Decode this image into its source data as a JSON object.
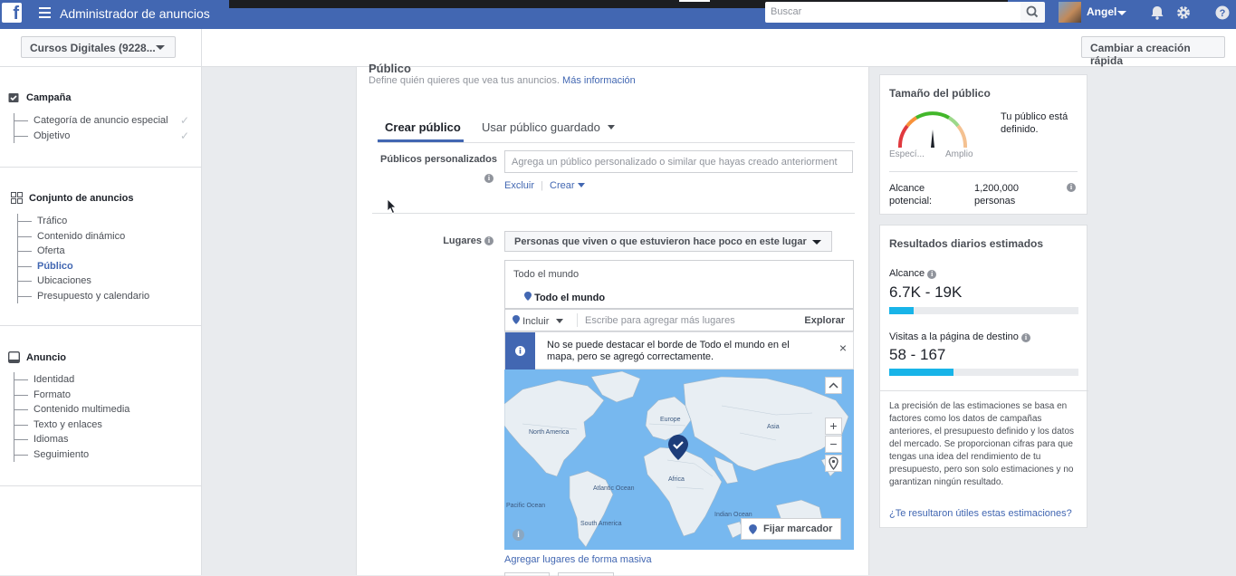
{
  "topbar": {
    "app_title": "Administrador de anuncios",
    "search_placeholder": "Buscar",
    "user_name": "Angel"
  },
  "subbar": {
    "account_label": "Cursos Digitales (9228...",
    "quick_create_label": "Cambiar a creación rápida"
  },
  "sidebar": {
    "campaign": {
      "title": "Campaña",
      "items": [
        "Categoría de anuncio especial",
        "Objetivo"
      ]
    },
    "adset": {
      "title": "Conjunto de anuncios",
      "items": [
        "Tráfico",
        "Contenido dinámico",
        "Oferta",
        "Público",
        "Ubicaciones",
        "Presupuesto y calendario"
      ],
      "active_index": 3
    },
    "ad": {
      "title": "Anuncio",
      "items": [
        "Identidad",
        "Formato",
        "Contenido multimedia",
        "Texto y enlaces",
        "Idiomas",
        "Seguimiento"
      ]
    }
  },
  "audience": {
    "title": "Público",
    "description": "Define quién quieres que vea tus anuncios.",
    "more_info_link": "Más información",
    "tabs": [
      "Crear público",
      "Usar público guardado"
    ],
    "custom_audiences_label": "Públicos personalizados",
    "custom_audiences_placeholder": "Agrega un público personalizado o similar que hayas creado anteriorment",
    "exclude_link": "Excluir",
    "create_link": "Crear",
    "places_label": "Lugares",
    "places_dropdown": "Personas que viven o que estuvieron hace poco en este lugar",
    "locations_header": "Todo el mundo",
    "selected_location": "Todo el mundo",
    "include_label": "Incluir",
    "add_places_placeholder": "Escribe para agregar más lugares",
    "explore_label": "Explorar",
    "notice_text": "No se puede destacar el borde de Todo el mundo en el mapa, pero se agregó correctamente.",
    "map_labels": [
      "North America",
      "Atlantic Ocean",
      "Pacific Ocean",
      "Indian Ocean",
      "South America",
      "Africa",
      "Asia",
      "Europe"
    ],
    "pin_marker_label": "Fijar marcador",
    "bulk_link": "Agregar lugares de forma masiva"
  },
  "audience_size": {
    "title": "Tamaño del público",
    "status": "Tu público está definido.",
    "gauge_left": "Especí...",
    "gauge_right": "Amplio",
    "reach_label": "Alcance potencial:",
    "reach_value": "1,200,000 personas"
  },
  "daily_results": {
    "title": "Resultados diarios estimados",
    "reach_label": "Alcance",
    "reach_value": "6.7K - 19K",
    "reach_fill": 0.13,
    "visits_label": "Visitas a la página de destino",
    "visits_value": "58 - 167",
    "visits_fill": 0.34,
    "disclaimer": "La precisión de las estimaciones se basa en factores como los datos de campañas anteriores, el presupuesto definido y los datos del mercado. Se proporcionan cifras para que tengas una idea del rendimiento de tu presupuesto, pero son solo estimaciones y no garantizan ningún resultado.",
    "feedback_link": "¿Te resultaron útiles estas estimaciones?"
  },
  "colors": {
    "brand": "#4267b2",
    "progress": "#18b4e8",
    "map_water": "#77b8ef",
    "map_land": "#e8eef3"
  }
}
